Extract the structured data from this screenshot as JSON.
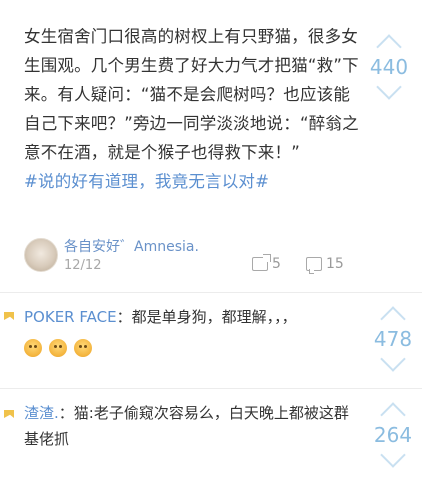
{
  "post": {
    "text": "女生宿舍门口很高的树杈上有只野猫，很多女生围观。几个男生费了好大力气才把猫“救”下来。有人疑问：“猫不是会爬树吗？也应该能自己下来吧？”旁边一同学淡淡地说：“醉翁之意不在酒，就是个猴子也得救下来！”",
    "hashtag": "#说的好有道理，我竟无言以对#",
    "vote_count": "440",
    "author": "各自安好゛Amnesia.",
    "date": "12/12",
    "reposts": "5",
    "comments": "15"
  },
  "replies": [
    {
      "user": "POKER FACE",
      "text": "：都是单身狗，都理解，，，",
      "emojis": [
        "sad-face-emoji",
        "sad-face-emoji",
        "sad-face-emoji"
      ],
      "vote_count": "478"
    },
    {
      "user": "渣渣.",
      "text": "：猫:老子偷窥次容易么，白天晚上都被这群基佬抓",
      "vote_count": "264"
    }
  ],
  "colors": {
    "link": "#5b8fd0",
    "vote": "#8bbce0",
    "quote_mark": "#f0c24b"
  }
}
